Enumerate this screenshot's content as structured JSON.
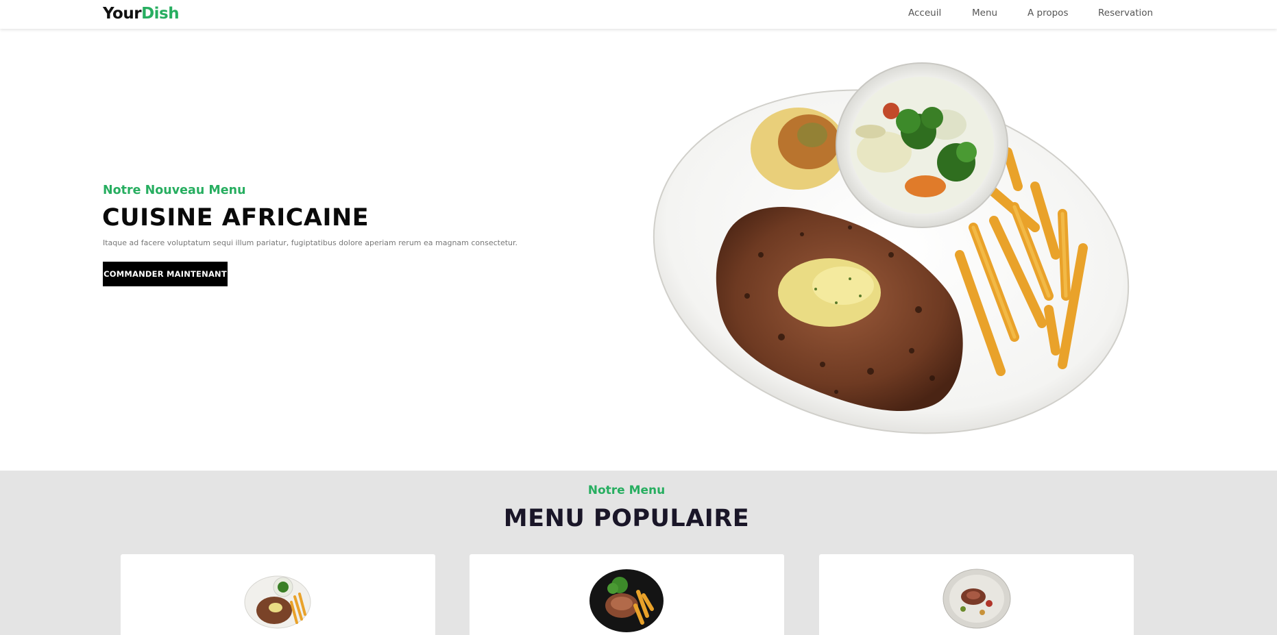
{
  "navbar": {
    "logo_part1": "Your",
    "logo_part2": "Dish",
    "links": [
      "Acceuil",
      "Menu",
      "A propos",
      "Reservation"
    ]
  },
  "hero": {
    "subtitle": "Notre Nouveau Menu",
    "title": "CUISINE AFRICAINE",
    "description": "Itaque ad facere voluptatum sequi illum pariatur, fugiptatibus dolore aperiam rerum ea magnam consectetur.",
    "button_label": "COMMANDER MAINTENANT"
  },
  "menu": {
    "subtitle": "Notre Menu",
    "title": "MENU POPULAIRE"
  },
  "colors": {
    "accent": "#27ae60",
    "dark": "#000000",
    "section_bg": "#e4e4e4"
  }
}
